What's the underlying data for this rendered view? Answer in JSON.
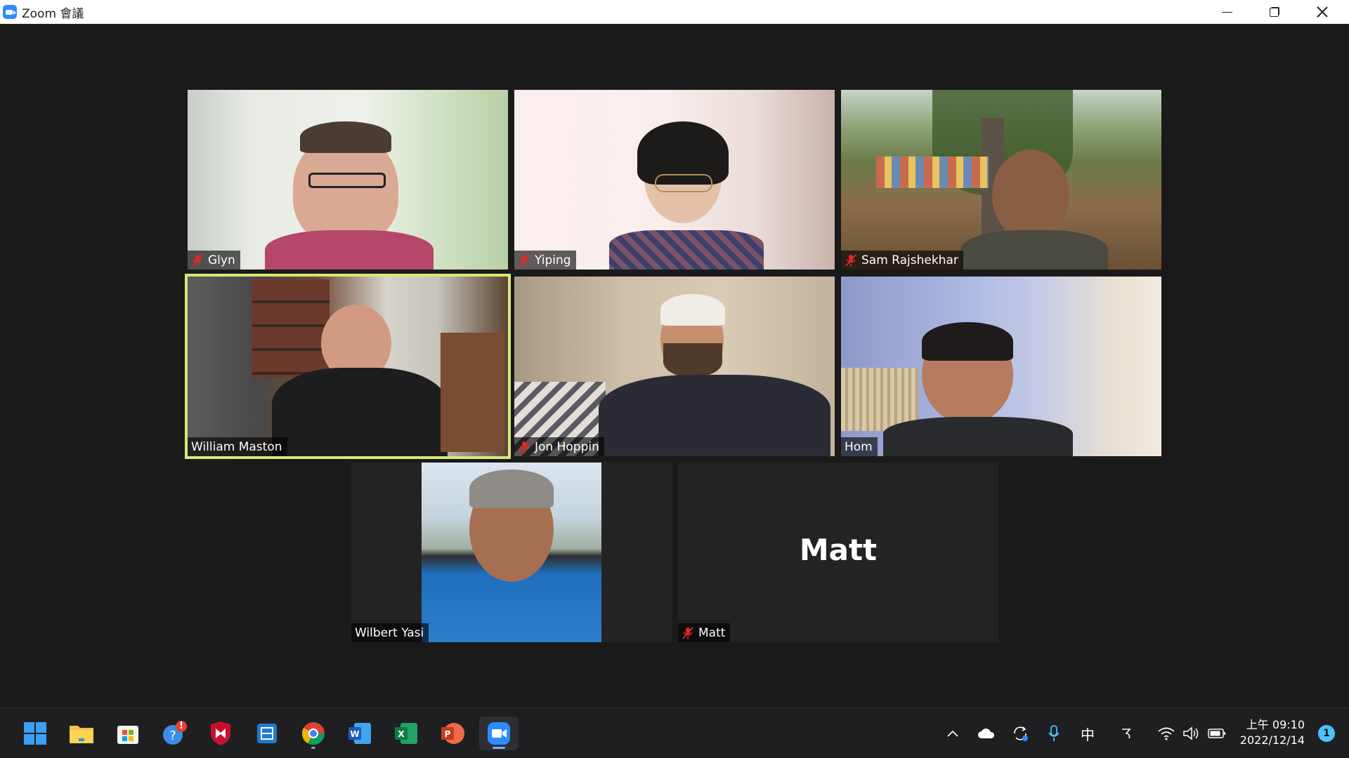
{
  "window": {
    "title": "Zoom 會議"
  },
  "participants": [
    {
      "name": "Glyn",
      "muted": true
    },
    {
      "name": "Yiping",
      "muted": true
    },
    {
      "name": "Sam Rajshekhar",
      "muted": true
    },
    {
      "name": "William Maston",
      "muted": false,
      "active_speaker": true
    },
    {
      "name": "Jon Hoppin",
      "muted": true
    },
    {
      "name": "Hom",
      "muted": false
    },
    {
      "name": "Wilbert Yasi",
      "muted": false
    },
    {
      "name": "Matt",
      "muted": true,
      "video_off": true,
      "placeholder_text": "Matt"
    }
  ],
  "taskbar": {
    "apps": [
      "start-icon",
      "file-explorer-icon",
      "store-icon",
      "help-icon",
      "mcafee-icon",
      "app-icon",
      "chrome-icon",
      "word-icon",
      "excel-icon",
      "powerpoint-icon",
      "zoom-icon"
    ],
    "help_badge": "!",
    "ime_label": "中",
    "clock": {
      "ampm_time": "上午 09:10",
      "date": "2022/12/14"
    },
    "notification_count": "1"
  },
  "colors": {
    "accent": "#2d8cff",
    "speaker_border": "#d8e878",
    "muted_red": "#e02828"
  }
}
